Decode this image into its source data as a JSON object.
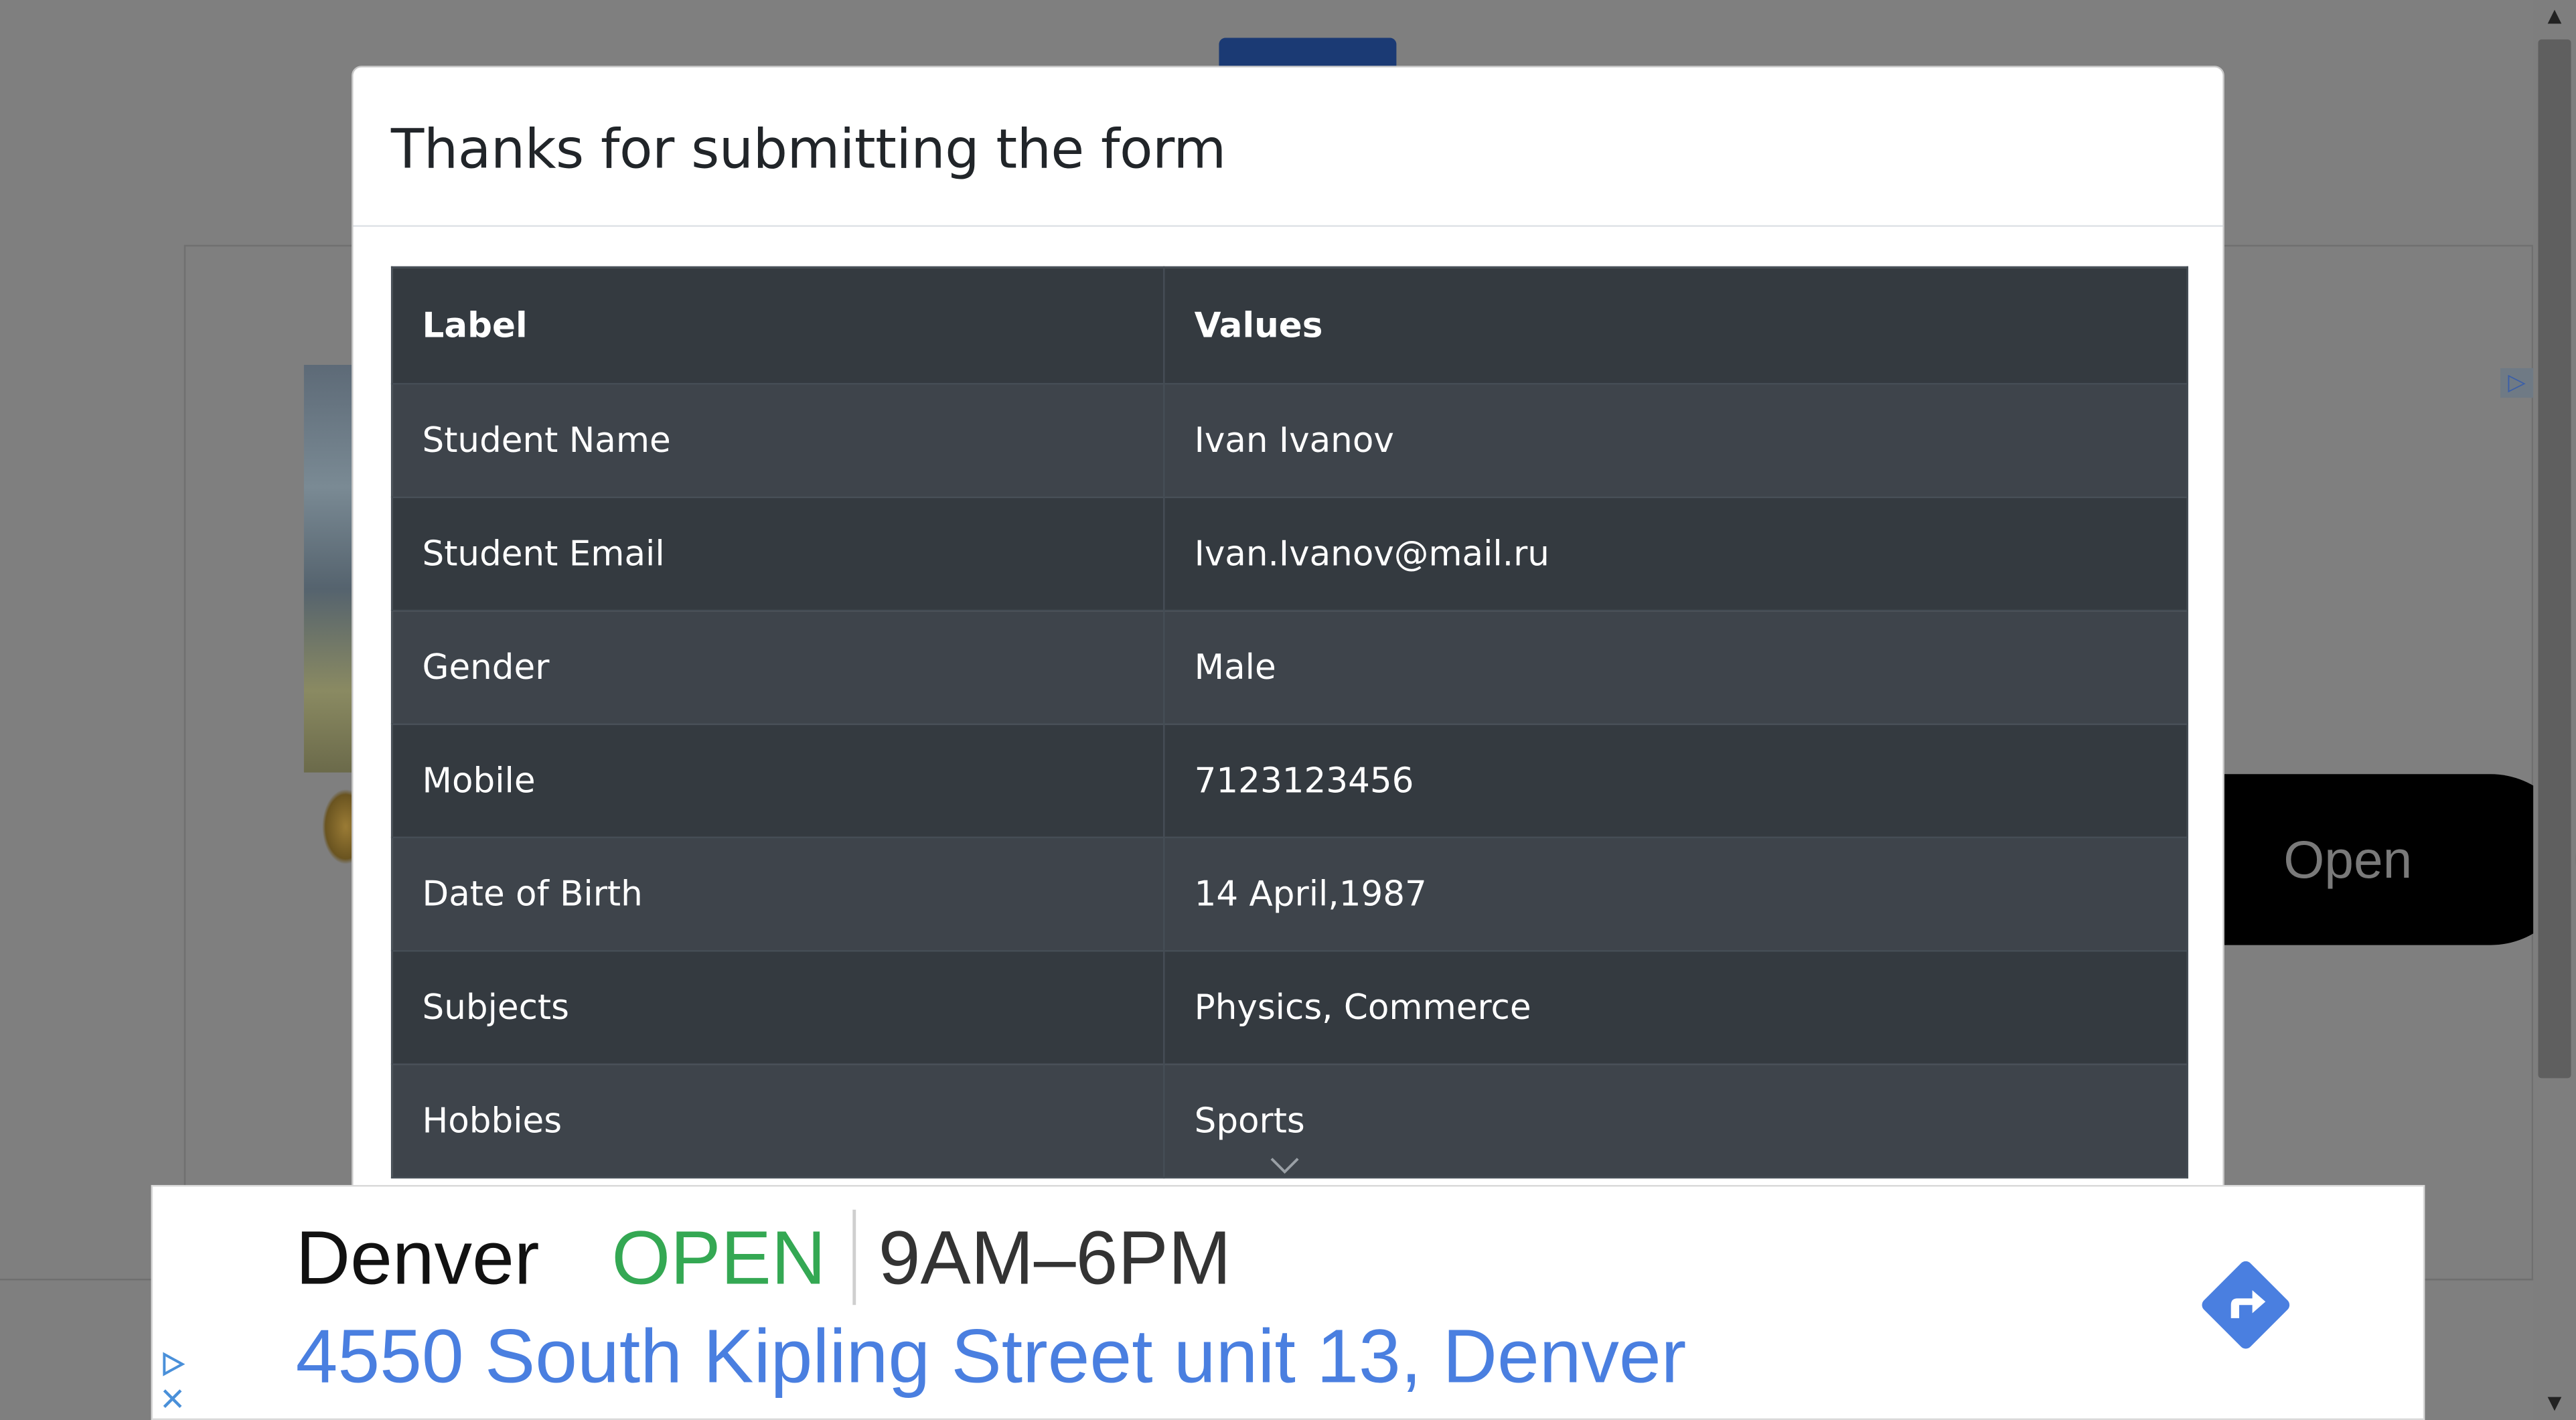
{
  "background": {
    "open_label": "Open",
    "ad_marker_icon": "ad-choices-icon"
  },
  "modal": {
    "title": "Thanks for submitting the form",
    "table": {
      "headers": [
        "Label",
        "Values"
      ],
      "rows": [
        {
          "label": "Student Name",
          "value": "Ivan Ivanov"
        },
        {
          "label": "Student Email",
          "value": "Ivan.Ivanov@mail.ru"
        },
        {
          "label": "Gender",
          "value": "Male"
        },
        {
          "label": "Mobile",
          "value": "7123123456"
        },
        {
          "label": "Date of Birth",
          "value": "14 April,1987"
        },
        {
          "label": "Subjects",
          "value": "Physics, Commerce"
        },
        {
          "label": "Hobbies",
          "value": "Sports"
        }
      ]
    }
  },
  "ad": {
    "city": "Denver",
    "status": "OPEN",
    "hours": "9AM–6PM",
    "address": "4550 South Kipling Street unit 13, Denver",
    "colors": {
      "status": "#34a853",
      "address": "#4a7fe0",
      "directions": "#4a7fe0"
    },
    "icons": [
      "directions-icon",
      "ad-choices-icon",
      "close-icon"
    ]
  }
}
